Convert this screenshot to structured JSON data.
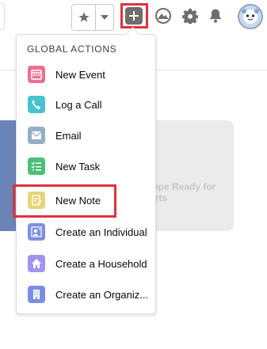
{
  "header": {
    "favorites_icon": "star-icon",
    "favorites_menu_icon": "chevron-down-icon",
    "global_actions_icon": "plus-icon",
    "trailhead_icon": "trailhead-icon",
    "setup_icon": "gear-icon",
    "notifications_icon": "bell-icon",
    "avatar_icon": "astro-avatar"
  },
  "background": {
    "card_text_line1": "lope Ready for",
    "card_text_line2": "erts"
  },
  "global_actions": {
    "title": "GLOBAL ACTIONS",
    "items": [
      {
        "label": "New Event",
        "icon": "calendar-icon",
        "color": "#eb7092"
      },
      {
        "label": "Log a Call",
        "icon": "phone-icon",
        "color": "#48c3cc"
      },
      {
        "label": "Email",
        "icon": "envelope-icon",
        "color": "#95aec5"
      },
      {
        "label": "New Task",
        "icon": "task-checklist-icon",
        "color": "#4bc076"
      },
      {
        "label": "New Note",
        "icon": "note-icon",
        "color": "#e6d478"
      },
      {
        "label": "Create an Individual",
        "icon": "individual-icon",
        "color": "#7f8de1"
      },
      {
        "label": "Create a Household",
        "icon": "household-icon",
        "color": "#a094ed"
      },
      {
        "label": "Create an Organiz...",
        "icon": "organization-icon",
        "color": "#7f8de1"
      }
    ]
  },
  "colors": {
    "highlight": "#e0323c",
    "header_button_gray": "#706e6b"
  }
}
